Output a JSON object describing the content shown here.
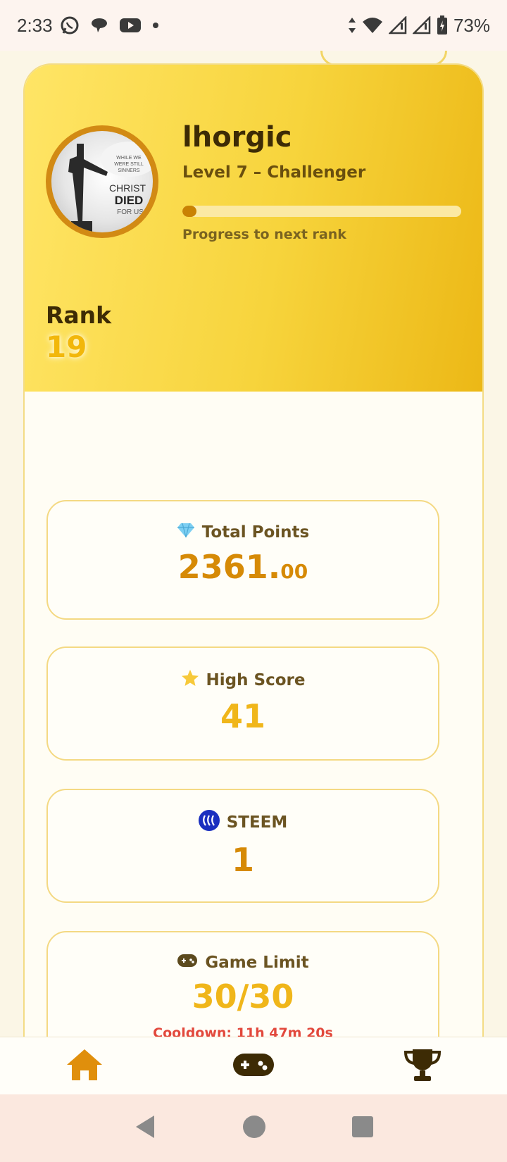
{
  "status_bar": {
    "time": "2:33",
    "battery": "73%",
    "left_icons": [
      "whatsapp-icon",
      "chat-icon",
      "youtube-icon",
      "dot-icon"
    ],
    "right_icons": [
      "data-arrows-icon",
      "wifi-icon",
      "signal-icon",
      "signal-icon",
      "battery-charging-icon"
    ]
  },
  "profile": {
    "username": "lhorgic",
    "level": "Level 7 – Challenger",
    "progress_fraction": 0.05,
    "progress_label": "Progress to next rank",
    "rank_label": "Rank",
    "rank_value": "19",
    "avatar_text": {
      "line1": "WHILE WE",
      "line2": "WERE STILL",
      "line3": "SINNERS",
      "line4": "CHRIST",
      "line5": "DIED",
      "line6": "FOR US"
    }
  },
  "stats": {
    "total_points": {
      "icon": "diamond-icon",
      "label": "Total Points",
      "value_main": "2361.",
      "value_decimal": "00"
    },
    "high_score": {
      "icon": "star-icon",
      "label": "High Score",
      "value": "41"
    },
    "steem": {
      "icon": "steem-icon",
      "label": "STEEM",
      "value": "1"
    },
    "game_limit": {
      "icon": "gamepad-icon",
      "label": "Game Limit",
      "value": "30/30",
      "cooldown": "Cooldown: 11h 47m 20s"
    }
  },
  "bottom_nav": {
    "items": [
      {
        "name": "home",
        "icon": "home-icon",
        "active": true
      },
      {
        "name": "games",
        "icon": "gamepad-icon",
        "active": false
      },
      {
        "name": "leaderboard",
        "icon": "trophy-icon",
        "active": false
      }
    ]
  },
  "colors": {
    "accent": "#d68a06",
    "gold": "#f2b70a",
    "cooldown": "#e2483c",
    "steem_blue": "#1a2fbf"
  }
}
